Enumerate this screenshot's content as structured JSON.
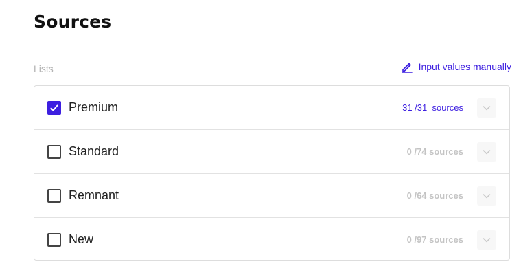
{
  "header": {
    "title": "Sources"
  },
  "lists_section": {
    "label": "Lists",
    "manual_link_label": "Input values manually",
    "accent_color": "#3d1fe0"
  },
  "lists": [
    {
      "label": "Premium",
      "checked": true,
      "count": "31 /31  sources"
    },
    {
      "label": "Standard",
      "checked": false,
      "count": "0 /74 sources"
    },
    {
      "label": "Remnant",
      "checked": false,
      "count": "0 /64 sources"
    },
    {
      "label": "New",
      "checked": false,
      "count": "0 /97 sources"
    }
  ],
  "icons": {
    "manual_link": "pencil-icon",
    "checkbox_checked": "checkmark-icon",
    "row_expand": "chevron-down-icon"
  }
}
